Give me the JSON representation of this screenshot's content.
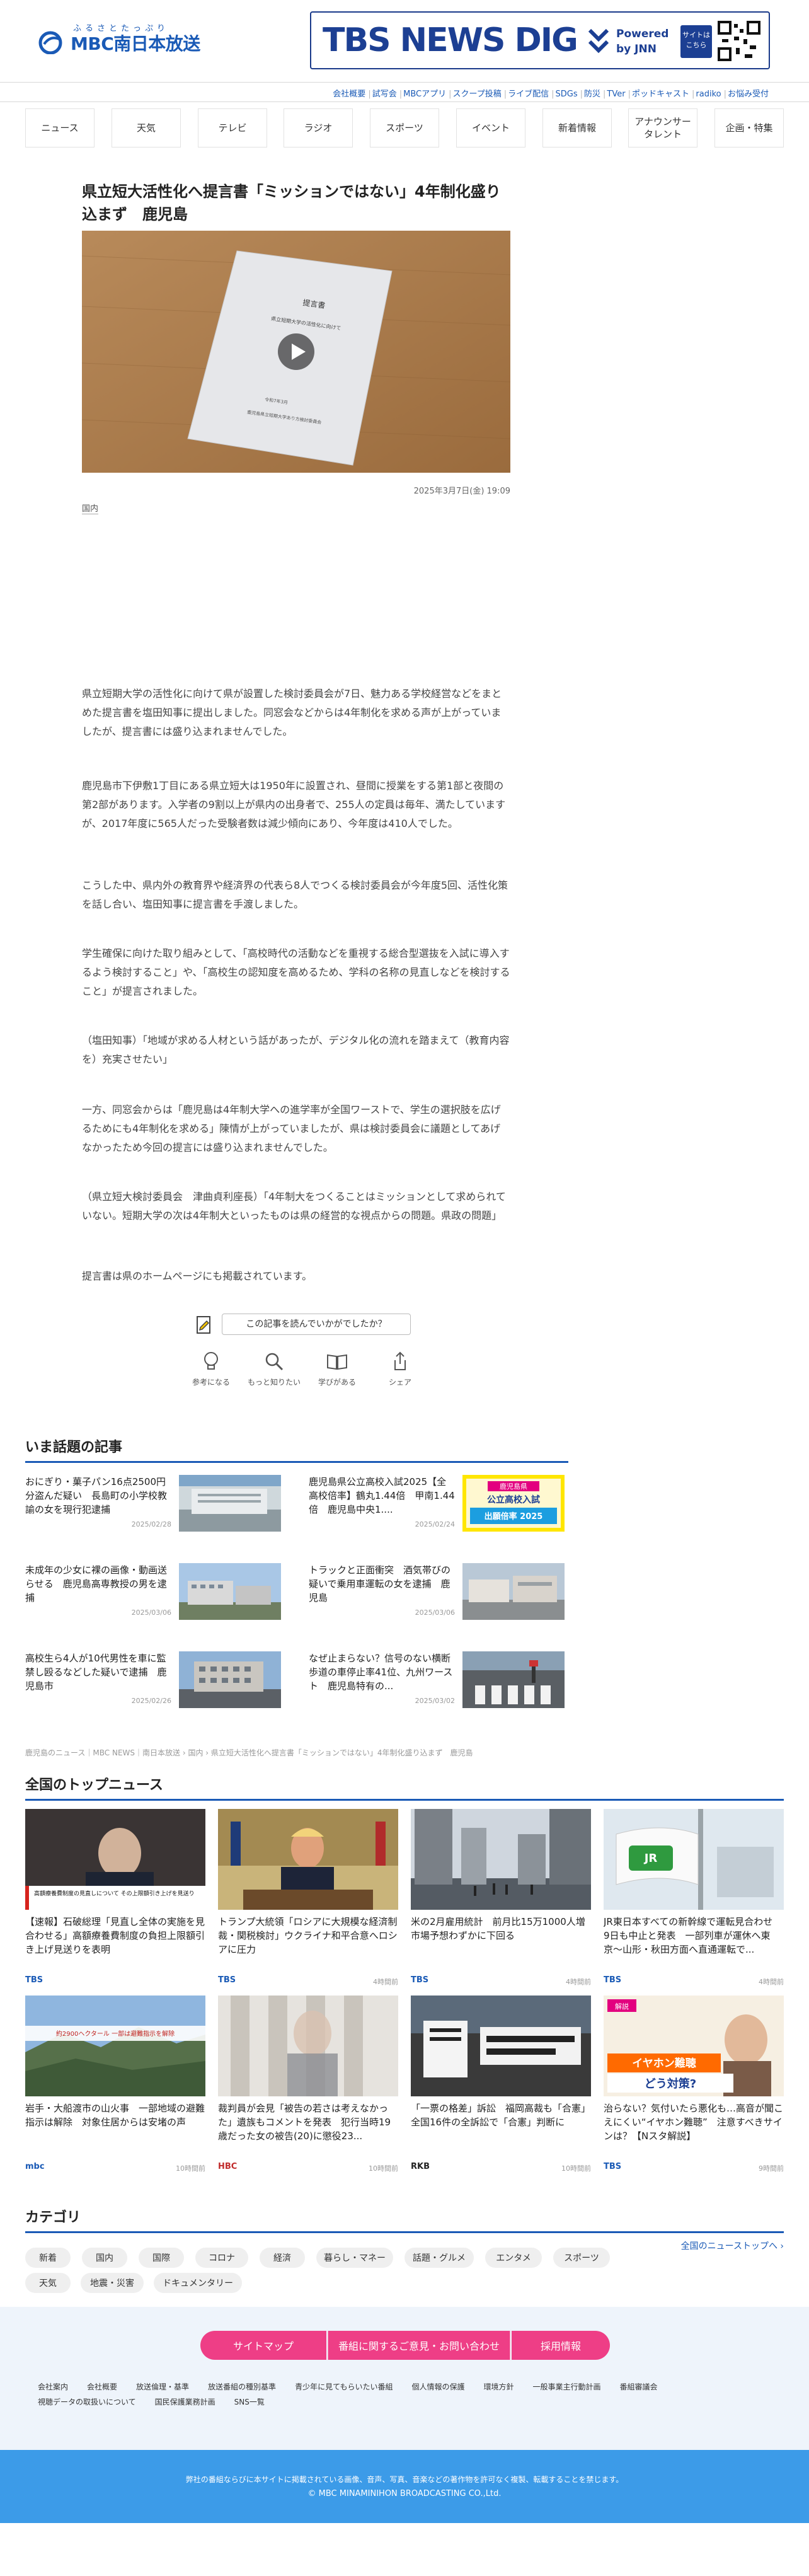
{
  "header": {
    "logo_ruby": "ふるさとたっぷり",
    "logo_name": "MBC南日本放送",
    "dig_title": "TBS NEWS DIG",
    "dig_powered": "Powered\nby JNN",
    "dig_site": "サイトは\nこちら"
  },
  "util_links": [
    "会社概要",
    "試写会",
    "MBCアプリ",
    "スクープ投稿",
    "ライブ配信",
    "SDGs",
    "防災",
    "TVer",
    "ポッドキャスト",
    "radiko",
    "お悩み受付"
  ],
  "nav": [
    "ニュース",
    "天気",
    "テレビ",
    "ラジオ",
    "スポーツ",
    "イベント",
    "新着情報",
    "アナウンサー\nタレント",
    "企画・特集"
  ],
  "article": {
    "title": "県立短大活性化へ提言書「ミッションではない」4年制化盛り込まず　鹿児島",
    "doc_lines": [
      "提言書",
      "県立短期大学の活性化に向けて",
      "令和7年3月",
      "鹿児島県立短期大学あり方検討委員会"
    ],
    "date": "2025年3月7日(金) 19:09",
    "category": "国内",
    "paragraphs": [
      "県立短期大学の活性化に向けて県が設置した検討委員会が7日、魅力ある学校経営などをまとめた提言書を塩田知事に提出しました。同窓会などからは4年制化を求める声が上がっていましたが、提言書には盛り込まれませんでした。",
      "鹿児島市下伊敷1丁目にある県立短大は1950年に設置され、昼間に授業をする第1部と夜間の第2部があります。入学者の9割以上が県内の出身者で、255人の定員は毎年、満たしていますが、2017年度に565人だった受験者数は減少傾向にあり、今年度は410人でした。",
      "こうした中、県内外の教育界や経済界の代表ら8人でつくる検討委員会が今年度5回、活性化策を話し合い、塩田知事に提言書を手渡しました。",
      "学生確保に向けた取り組みとして、「高校時代の活動などを重視する総合型選抜を入試に導入するよう検討すること」や、「高校生の認知度を高めるため、学科の名称の見直しなどを検討すること」が提言されました。",
      "（塩田知事）「地域が求める人材という話があったが、デジタル化の流れを踏まえて（教育内容を）充実させたい」",
      "一方、同窓会からは「鹿児島は4年制大学への進学率が全国ワーストで、学生の選択肢を広げるためにも4年制化を求める」陳情が上がっていましたが、県は検討委員会に議題としてあげなかったため今回の提言には盛り込まれませんでした。",
      "（県立短大検討委員会　津曲貞利座長）「4年制大をつくることはミッションとして求められていない。短期大学の次は4年制大といったものは県の経営的な視点からの問題。県政の問題」",
      "提言書は県のホームページにも掲載されています。"
    ],
    "feedback_label": "この記事を読んでいかがでしたか？",
    "reactions": [
      "参考になる",
      "もっと知りたい",
      "学びがある",
      "シェア"
    ]
  },
  "trending": {
    "heading": "いま話題の記事",
    "items": [
      {
        "title": "おにぎり・菓子パン16点2500円分盗んだ疑い　長島町の小学校教諭の女を現行犯逮捕",
        "date": "2025/02/28"
      },
      {
        "title": "鹿児島県公立高校入試2025【全高校倍率】鶴丸1.44倍　甲南1.44倍　鹿児島中央1....",
        "date": "2025/02/24",
        "badge_top": "鹿児島県",
        "badge_mid": "公立高校入試",
        "badge_bot": "出願倍率 2025"
      },
      {
        "title": "未成年の少女に裸の画像・動画送らせる　鹿児島高専教授の男を逮捕",
        "date": "2025/03/06"
      },
      {
        "title": "トラックと正面衝突　酒気帯びの疑いで乗用車運転の女を逮捕　鹿児島",
        "date": "2025/03/06"
      },
      {
        "title": "高校生ら4人が10代男性を車に監禁し殴るなどした疑いで逮捕　鹿児島市",
        "date": "2025/02/26"
      },
      {
        "title": "なぜ止まらない？信号のない横断歩道の車停止率41位、九州ワースト　鹿児島特有の...",
        "date": "2025/03/02"
      }
    ]
  },
  "breadcrumb": "鹿児島のニュース｜MBC NEWS｜南日本放送 › 国内 › 県立短大活性化へ提言書「ミッションではない」4年制化盛り込まず　鹿児島",
  "top_news": {
    "heading": "全国のトップニュース",
    "items": [
      {
        "title": "【速報】石破総理「見直し全体の実施を見合わせる」高額療養費制度の負担上限額引き上げ見送りを表明",
        "source": "TBS",
        "ago": "",
        "caption": "高額療養費制度の見直しについて その上限額引き上げを見送り"
      },
      {
        "title": "トランプ大統領「ロシアに大規模な経済制裁・関税検討」ウクライナ和平合意へロシアに圧力",
        "source": "TBS",
        "ago": "4時間前"
      },
      {
        "title": "米の2月雇用統計　前月比15万1000人増　市場予想わずかに下回る",
        "source": "TBS",
        "ago": "4時間前"
      },
      {
        "title": "JR東日本すべての新幹線で運転見合わせ　9日も中止と発表　一部列車が運休へ東京〜山形・秋田方面へ直通運転で...",
        "source": "TBS",
        "ago": "4時間前"
      },
      {
        "title": "岩手・大船渡市の山火事　一部地域の避難指示は解除　対象住居からは安堵の声",
        "source": "mbc",
        "ago": "10時間前",
        "caption": "約2900ヘクタール 一部は避難指示を解除"
      },
      {
        "title": "裁判員が会見「被告の若さは考えなかった」遺族もコメントを発表　犯行当時19歳だった女の被告(20)に懲役23...",
        "source": "HBC",
        "ago": "10時間前"
      },
      {
        "title": "「一票の格差」訴訟　福岡高裁も「合憲」　全国16件の全訴訟で「合憲」判断に",
        "source": "RKB",
        "ago": "10時間前"
      },
      {
        "title": "治らない？気付いたら悪化も…高音が聞こえにくい“イヤホン難聴”　注意すべきサインは？【Nスタ解説】",
        "source": "TBS",
        "ago": "9時間前",
        "caption_top": "解説",
        "caption_main": "イヤホン難聴",
        "caption_tail": "どう対策?"
      }
    ],
    "more": "全国のニューストップへ ›"
  },
  "categories": {
    "heading": "カテゴリ",
    "items": [
      "新着",
      "国内",
      "国際",
      "コロナ",
      "経済",
      "暮らし・マネー",
      "話題・グルメ",
      "エンタメ",
      "スポーツ",
      "天気",
      "地震・災害",
      "ドキュメンタリー"
    ]
  },
  "footer": {
    "buttons": [
      "サイトマップ",
      "番組に関するご意見・お問い合わせ",
      "採用情報"
    ],
    "links_row1": [
      "会社案内",
      "会社概要",
      "放送倫理・基準",
      "放送番組の種別基準",
      "青少年に見てもらいたい番組",
      "個人情報の保護",
      "環境方針",
      "一般事業主行動計画",
      "番組審議会"
    ],
    "links_row2": [
      "視聴データの取扱いについて",
      "国民保護業務計画",
      "SNS一覧"
    ],
    "notice": "弊社の番組ならびに本サイトに掲載されている画像、音声、写真、音楽などの著作物を許可なく複製、転載することを禁じます。",
    "copyright": "© MBC MINAMINIHON BROADCASTING CO.,Ltd."
  },
  "colors": {
    "brand": "#1a5ab6",
    "accent_pink": "#ee3e86",
    "footer_blue": "#3c9be8"
  }
}
